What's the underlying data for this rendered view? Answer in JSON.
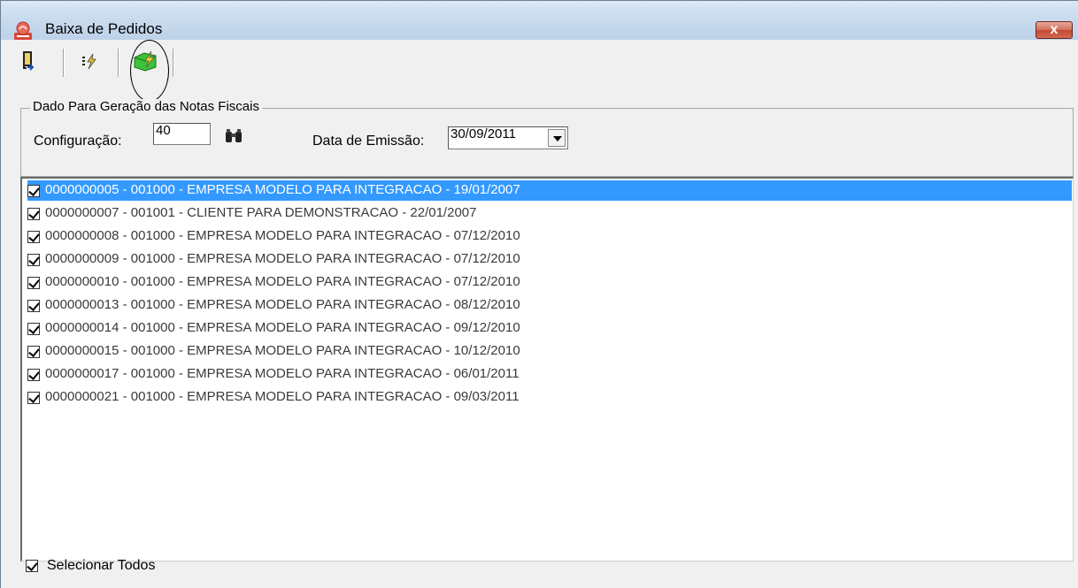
{
  "window": {
    "title": "Baixa de Pedidos",
    "close_label": "x"
  },
  "toolbar": {
    "buttons": [
      {
        "icon": "exit-door-icon"
      },
      {
        "icon": "process-icon"
      },
      {
        "icon": "generate-invoice-icon"
      }
    ]
  },
  "group": {
    "title": "Dado Para Geração das Notas Fiscais",
    "config_label": "Configuração:",
    "config_value": "40",
    "date_label": "Data de Emissão:",
    "date_value": "30/09/2011"
  },
  "list": {
    "items": [
      {
        "text": "0000000005 - 001000 - EMPRESA MODELO PARA INTEGRACAO - 19/01/2007",
        "checked": true,
        "selected": true
      },
      {
        "text": "0000000007 - 001001 - CLIENTE PARA DEMONSTRACAO - 22/01/2007",
        "checked": true,
        "selected": false
      },
      {
        "text": "0000000008 - 001000 - EMPRESA MODELO PARA INTEGRACAO - 07/12/2010",
        "checked": true,
        "selected": false
      },
      {
        "text": "0000000009 - 001000 - EMPRESA MODELO PARA INTEGRACAO - 07/12/2010",
        "checked": true,
        "selected": false
      },
      {
        "text": "0000000010 - 001000 - EMPRESA MODELO PARA INTEGRACAO - 07/12/2010",
        "checked": true,
        "selected": false
      },
      {
        "text": "0000000013 - 001000 - EMPRESA MODELO PARA INTEGRACAO - 08/12/2010",
        "checked": true,
        "selected": false
      },
      {
        "text": "0000000014 - 001000 - EMPRESA MODELO PARA INTEGRACAO - 09/12/2010",
        "checked": true,
        "selected": false
      },
      {
        "text": "0000000015 - 001000 - EMPRESA MODELO PARA INTEGRACAO - 10/12/2010",
        "checked": true,
        "selected": false
      },
      {
        "text": "0000000017 - 001000 - EMPRESA MODELO PARA INTEGRACAO - 06/01/2011",
        "checked": true,
        "selected": false
      },
      {
        "text": "0000000021 - 001000 - EMPRESA MODELO PARA INTEGRACAO - 09/03/2011",
        "checked": true,
        "selected": false
      }
    ]
  },
  "footer": {
    "select_all_label": "Selecionar Todos",
    "select_all_checked": true
  },
  "colors": {
    "selection": "#3399ff",
    "titlebar": "#c9dbee",
    "close_button": "#c24a34"
  }
}
